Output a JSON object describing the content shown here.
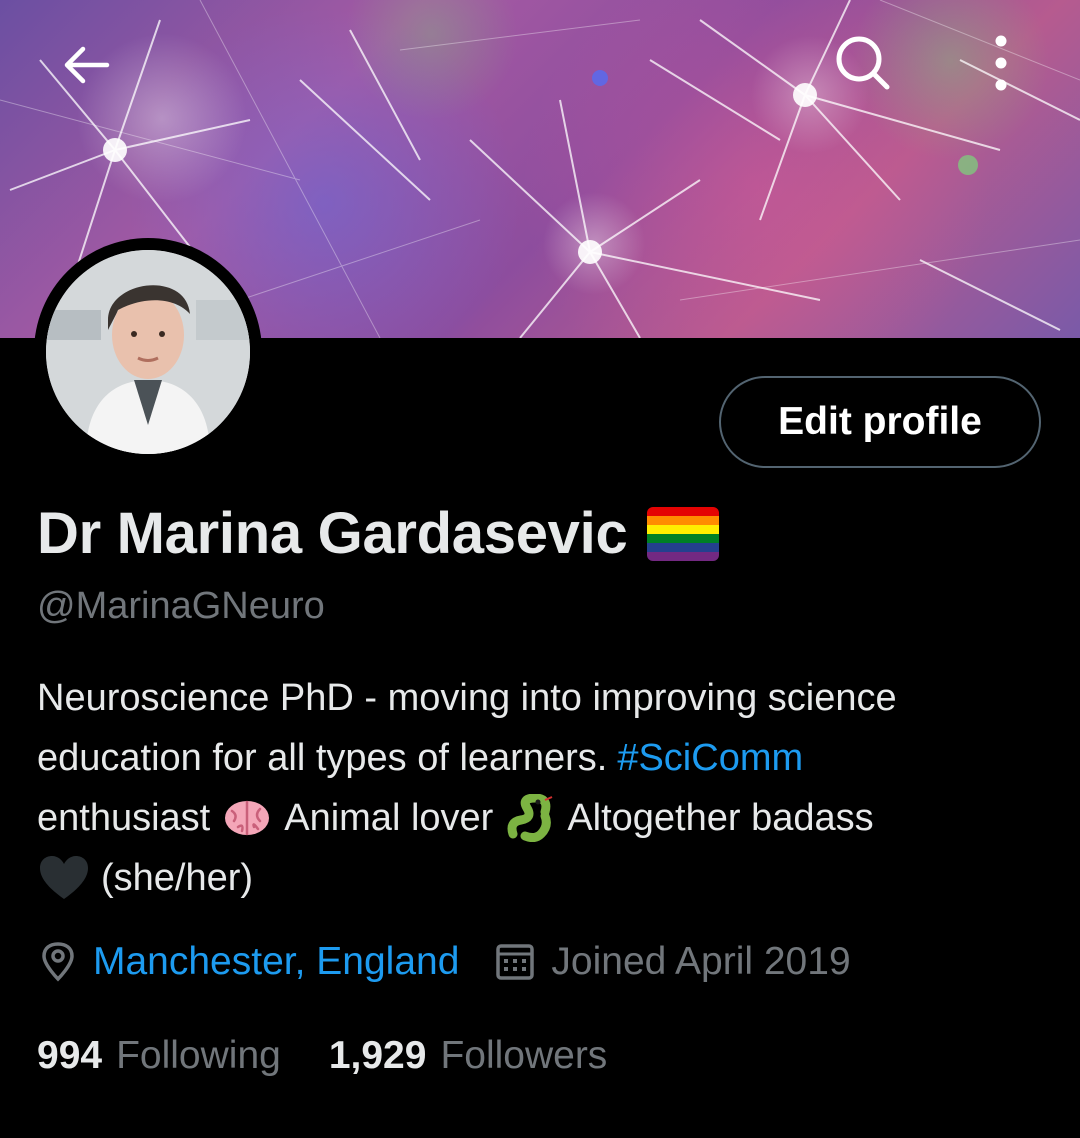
{
  "header": {
    "back_icon": "arrow-left-icon",
    "search_icon": "search-icon",
    "more_icon": "more-vertical-icon"
  },
  "profile": {
    "name": "Dr Marina Gardasevic",
    "handle": "@MarinaGNeuro",
    "edit_label": "Edit profile",
    "bio": {
      "line1": "Neuroscience PhD - moving into improving science",
      "line2_text": "education for all types of learners.",
      "line2_hashtag": "#SciComm",
      "line3_a": "enthusiast",
      "line3_b": "Animal lover",
      "line3_c": "Altogether badass",
      "line4": "(she/her)"
    },
    "location": "Manchester, England",
    "joined": "Joined April 2019",
    "following_count": "994",
    "following_label": "Following",
    "followers_count": "1,929",
    "followers_label": "Followers"
  },
  "colors": {
    "background": "#000000",
    "accent": "#1d9bf0",
    "muted": "#71767b",
    "text": "#e7e9ea",
    "button_border": "#536471"
  }
}
